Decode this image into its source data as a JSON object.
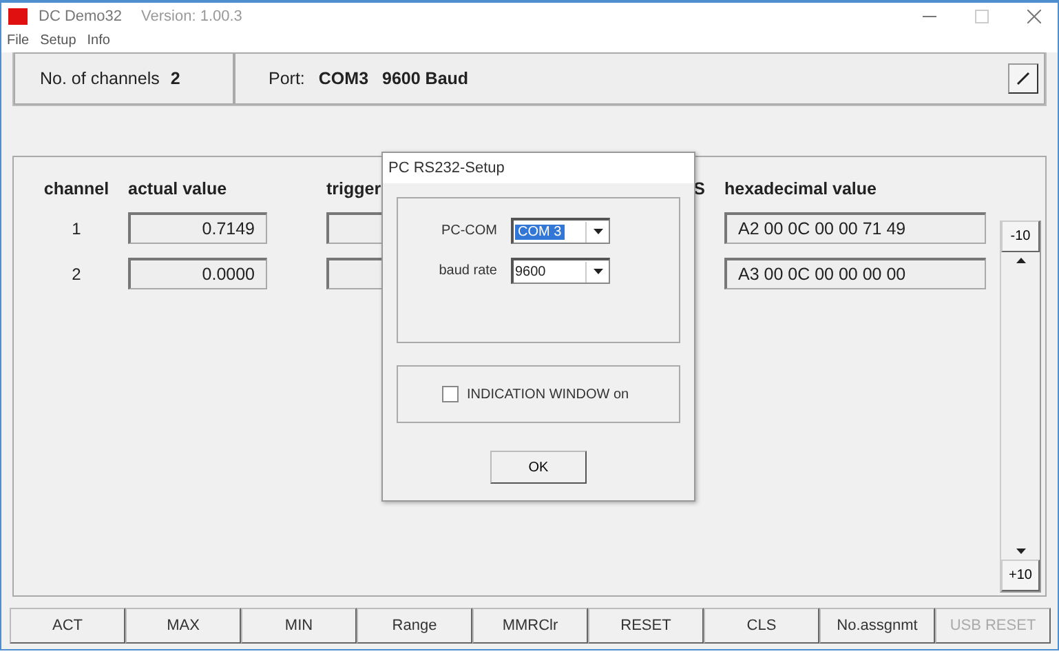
{
  "window": {
    "title": "DC Demo32",
    "version": "Version: 1.00.3"
  },
  "menu": [
    "File",
    "Setup",
    "Info"
  ],
  "status": {
    "channels_label": "No. of channels",
    "channels_value": "2",
    "port_label": "Port:",
    "port_value": "COM3",
    "baud": "9600 Baud"
  },
  "table": {
    "columns": [
      "channel",
      "actual value",
      "trigger",
      "S",
      "hexadecimal value"
    ],
    "rows": [
      {
        "channel": "1",
        "actual_value": "0.7149",
        "hex": "A2 00 0C 00 00 71 49"
      },
      {
        "channel": "2",
        "actual_value": "0.0000",
        "hex": "A3 00 0C 00 00 00 00"
      }
    ]
  },
  "scroll": {
    "minus": "-10",
    "plus": "+10"
  },
  "buttons": [
    {
      "label": "ACT",
      "disabled": false
    },
    {
      "label": "MAX",
      "disabled": false
    },
    {
      "label": "MIN",
      "disabled": false
    },
    {
      "label": "Range",
      "disabled": false
    },
    {
      "label": "MMRClr",
      "disabled": false
    },
    {
      "label": "RESET",
      "disabled": false
    },
    {
      "label": "CLS",
      "disabled": false
    },
    {
      "label": "No.assgnmt",
      "disabled": false
    },
    {
      "label": "USB RESET",
      "disabled": true
    }
  ],
  "dialog": {
    "title": "PC RS232-Setup",
    "pc_com_label": "PC-COM",
    "pc_com_value": "COM 3",
    "pc_com_highlighted": true,
    "baud_label": "baud rate",
    "baud_value": "9600",
    "checkbox": {
      "label": "INDICATION WINDOW on",
      "checked": false
    },
    "ok": "OK"
  }
}
